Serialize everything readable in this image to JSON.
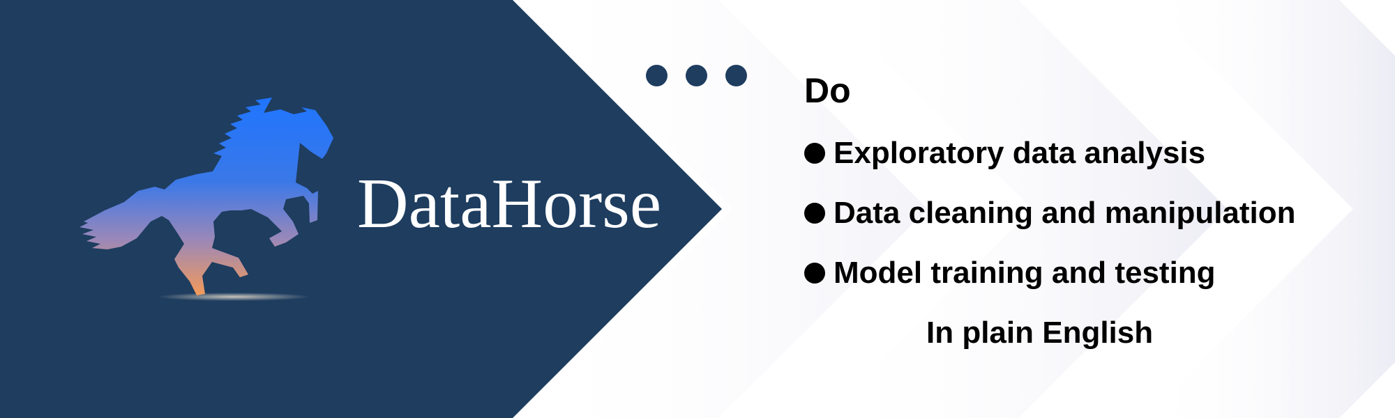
{
  "brand": {
    "name": "DataHorse",
    "icon": "horse-logo-icon"
  },
  "decor": {
    "dots_icon": "ellipsis-dots-icon",
    "bullet_icon": "bullet-dot-icon"
  },
  "content": {
    "heading": "Do",
    "features": [
      "Exploratory data analysis",
      "Data cleaning and manipulation",
      "Model training and testing"
    ],
    "tagline": "In plain English"
  },
  "colors": {
    "navy": "#1e3d5f",
    "logo_gradient_top": "#1f75ff",
    "logo_gradient_bottom": "#f39a5a",
    "text": "#000000",
    "background": "#ffffff"
  }
}
